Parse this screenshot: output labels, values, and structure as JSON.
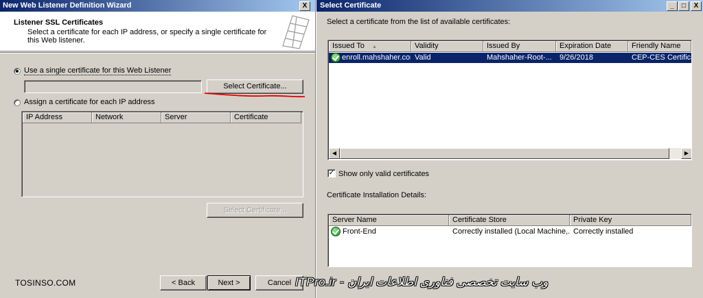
{
  "wizard": {
    "title": "New Web Listener Definition Wizard",
    "close_glyph": "X",
    "header_title": "Listener SSL Certificates",
    "header_desc": "Select a certificate for each IP address, or specify a single certificate for this Web listener.",
    "option_single": "Use a single certificate for this Web Listener",
    "single_cert_value": "",
    "select_cert_label": "Select Certificate...",
    "option_each": "Assign a certificate for each IP address",
    "columns": [
      "IP Address",
      "Network",
      "Server",
      "Certificate"
    ],
    "select_cert_disabled_label": "Select Certificate...",
    "back_label": "< Back",
    "next_label": "Next >",
    "cancel_label": "Cancel"
  },
  "dialog": {
    "title": "Select Certificate",
    "minimize_glyph": "_",
    "maximize_glyph": "□",
    "close_glyph": "X",
    "instruction": "Select a certificate from the list of available certificates:",
    "columns": [
      "Issued To",
      "Validity",
      "Issued By",
      "Expiration Date",
      "Friendly Name"
    ],
    "sort_glyph": "▲",
    "rows": [
      {
        "issued_to": "enroll.mahshaher.com",
        "validity": "Valid",
        "issued_by": "Mahshaher-Root-...",
        "expiration": "9/26/2018",
        "friendly_name": "CEP-CES Certificate"
      }
    ],
    "show_valid_label": "Show only valid certificates",
    "show_valid_checked": true,
    "check_glyph": "✓",
    "install_label": "Certificate Installation Details:",
    "install_columns": [
      "Server Name",
      "Certificate Store",
      "Private Key"
    ],
    "install_rows": [
      {
        "server": "Front-End",
        "store": "Correctly installed (Local Machine,...",
        "key": "Correctly installed"
      }
    ],
    "scroll_left_glyph": "◀",
    "scroll_right_glyph": "▶"
  },
  "watermark": {
    "left": "TOSINSO.COM",
    "right": "ITPro.ir - وب سایت تخصصی فناوری اطلاعات ایران"
  },
  "colors": {
    "title_active": "#0a246a",
    "selection": "#0a246a",
    "window_face": "#d4d0c8",
    "annotation_red": "#e00000"
  }
}
